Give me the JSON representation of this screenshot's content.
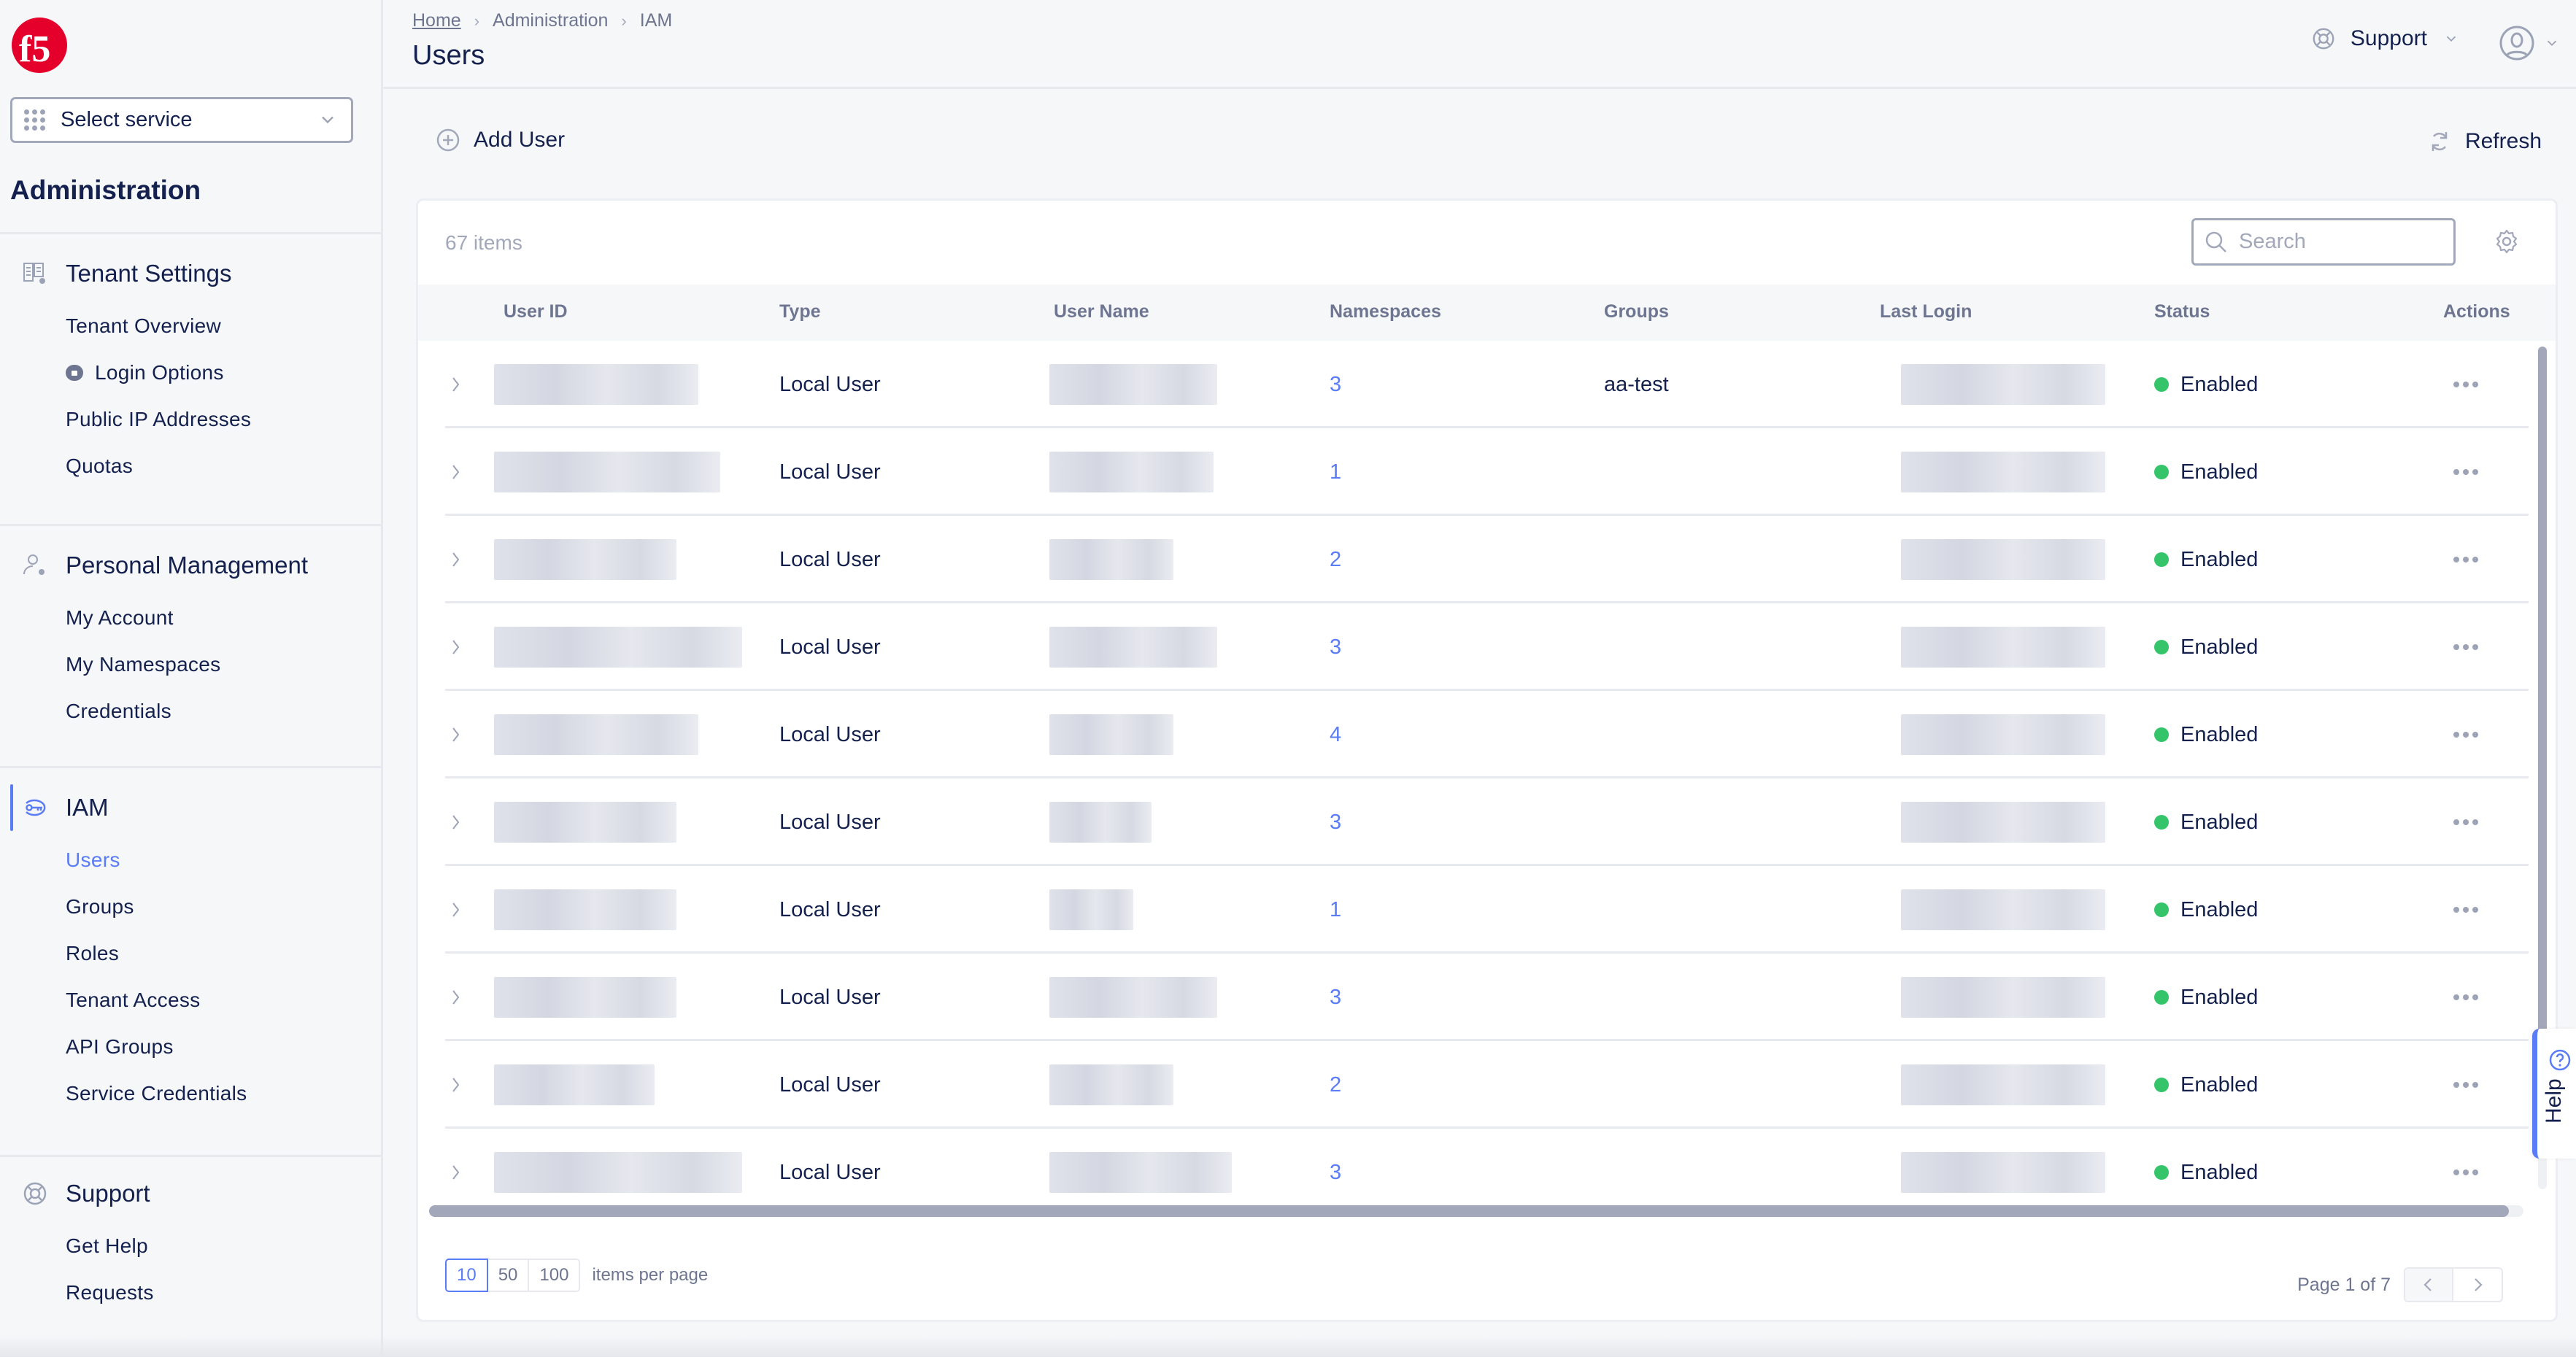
{
  "sidebar": {
    "select_service": {
      "label": "Select service"
    },
    "title": "Administration",
    "sections": [
      {
        "label": "Tenant Settings",
        "icon": "tenant-settings-icon",
        "items": [
          {
            "label": "Tenant Overview"
          },
          {
            "label": "Login Options",
            "badge_icon": "lock-icon"
          },
          {
            "label": "Public IP Addresses"
          },
          {
            "label": "Quotas"
          }
        ]
      },
      {
        "label": "Personal Management",
        "icon": "user-settings-icon",
        "items": [
          {
            "label": "My Account"
          },
          {
            "label": "My Namespaces"
          },
          {
            "label": "Credentials"
          }
        ]
      },
      {
        "label": "IAM",
        "icon": "key-icon",
        "active": true,
        "items": [
          {
            "label": "Users",
            "active": true
          },
          {
            "label": "Groups"
          },
          {
            "label": "Roles"
          },
          {
            "label": "Tenant Access"
          },
          {
            "label": "API Groups"
          },
          {
            "label": "Service Credentials"
          }
        ]
      },
      {
        "label": "Support",
        "icon": "lifebuoy-icon",
        "items": [
          {
            "label": "Get Help"
          },
          {
            "label": "Requests"
          }
        ]
      }
    ]
  },
  "header": {
    "breadcrumb": [
      "Home",
      "Administration",
      "IAM"
    ],
    "title": "Users",
    "support_label": "Support"
  },
  "toolbar": {
    "add_user_label": "Add User",
    "refresh_label": "Refresh"
  },
  "table": {
    "items_count": "67 items",
    "search_placeholder": "Search",
    "columns": [
      "User ID",
      "Type",
      "User Name",
      "Namespaces",
      "Groups",
      "Last Login",
      "Status",
      "Actions"
    ],
    "rows": [
      {
        "type": "Local User",
        "namespaces": "3",
        "groups": "aa-test",
        "status": "Enabled"
      },
      {
        "type": "Local User",
        "namespaces": "1",
        "groups": "",
        "status": "Enabled"
      },
      {
        "type": "Local User",
        "namespaces": "2",
        "groups": "",
        "status": "Enabled"
      },
      {
        "type": "Local User",
        "namespaces": "3",
        "groups": "",
        "status": "Enabled"
      },
      {
        "type": "Local User",
        "namespaces": "4",
        "groups": "",
        "status": "Enabled"
      },
      {
        "type": "Local User",
        "namespaces": "3",
        "groups": "",
        "status": "Enabled"
      },
      {
        "type": "Local User",
        "namespaces": "1",
        "groups": "",
        "status": "Enabled"
      },
      {
        "type": "Local User",
        "namespaces": "3",
        "groups": "",
        "status": "Enabled"
      },
      {
        "type": "Local User",
        "namespaces": "2",
        "groups": "",
        "status": "Enabled"
      },
      {
        "type": "Local User",
        "namespaces": "3",
        "groups": "",
        "status": "Enabled"
      }
    ],
    "redacted_columns": [
      "User ID",
      "User Name",
      "Last Login"
    ]
  },
  "pagination": {
    "page_sizes": [
      "10",
      "50",
      "100"
    ],
    "selected_page_size": "10",
    "per_page_label": "items per page",
    "page_text": "Page 1 of 7"
  },
  "help_tab": {
    "label": "Help"
  },
  "colors": {
    "accent": "#5a7cf5",
    "text_primary": "#14214f",
    "text_muted": "#6e7590",
    "status_enabled": "#35c46a",
    "brand_red": "#e4002b"
  }
}
